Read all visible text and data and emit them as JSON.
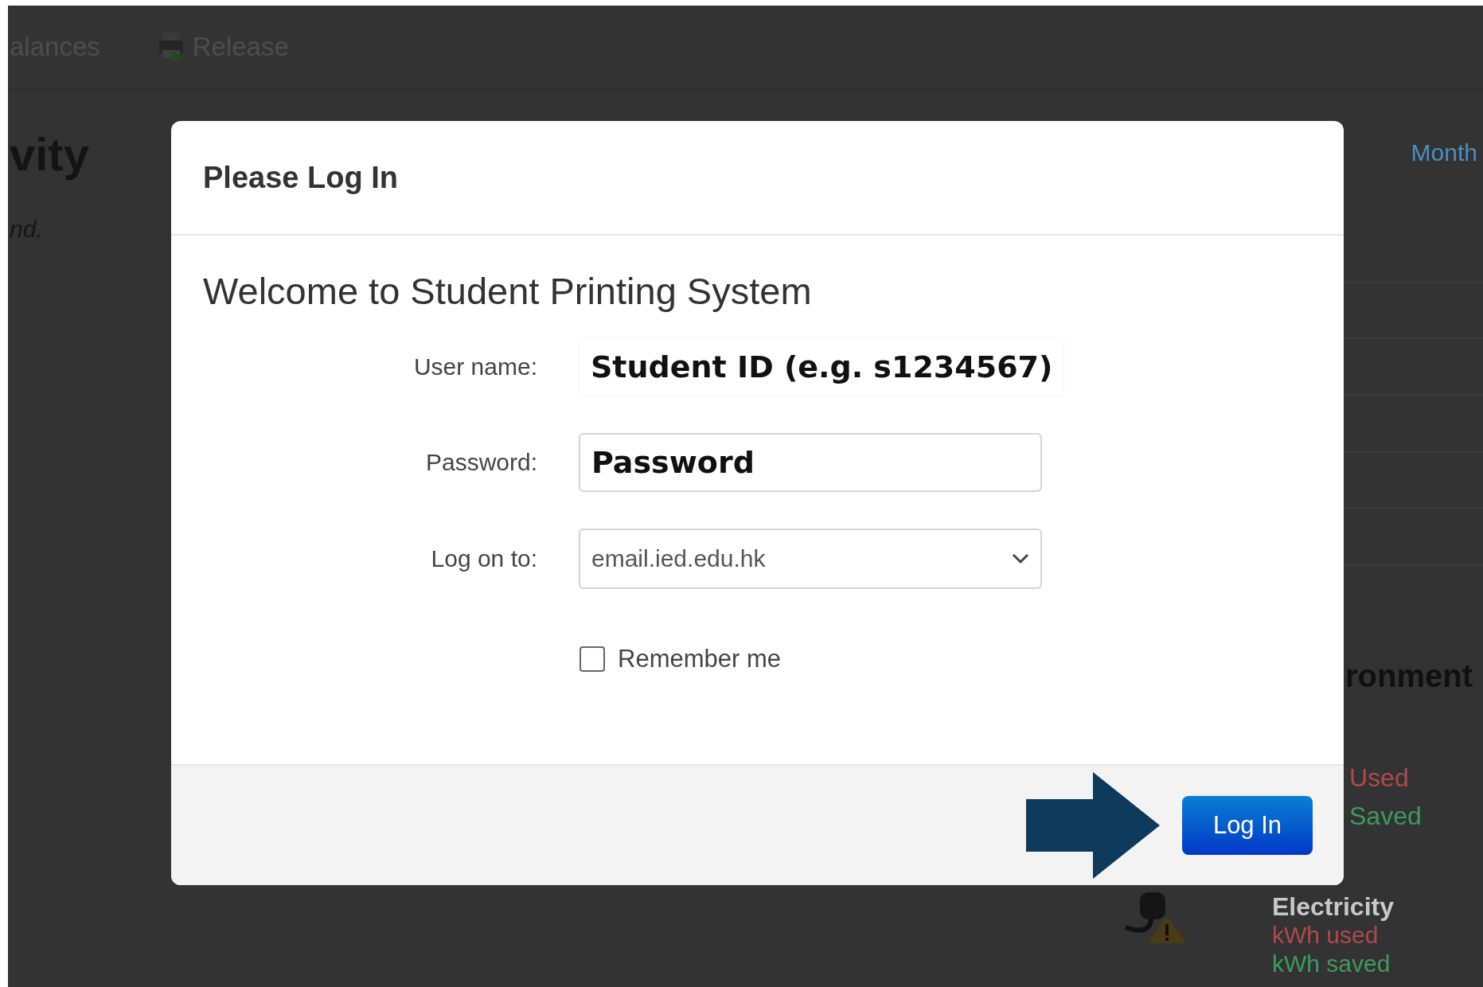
{
  "background_page": {
    "nav_items": [
      {
        "label": "alances",
        "kind": "plain"
      },
      {
        "label": "Release",
        "kind": "printer"
      }
    ],
    "heading": "vity",
    "note": "nd.",
    "period_link": "Month",
    "section_title": "ronment",
    "legend": [
      {
        "label": "Used",
        "color": "#b04a4a"
      },
      {
        "label": "Saved",
        "color": "#3f9a5e"
      }
    ],
    "electricity": {
      "title": "Electricity",
      "lines": [
        {
          "label": "kWh used",
          "color": "#b04a4a"
        },
        {
          "label": "kWh saved",
          "color": "#3f9a5e"
        }
      ]
    }
  },
  "dialog": {
    "title": "Please Log In",
    "welcome": "Welcome to Student Printing System",
    "fields": [
      {
        "kind": "text",
        "label": "User name:",
        "value": "Student ID (e.g. s1234567)"
      },
      {
        "kind": "password",
        "label": "Password:",
        "value": "Password"
      },
      {
        "kind": "select",
        "label": "Log on to:",
        "value": "email.ied.edu.hk"
      }
    ],
    "remember": {
      "label": "Remember me",
      "checked": false
    },
    "button": "Log In"
  }
}
